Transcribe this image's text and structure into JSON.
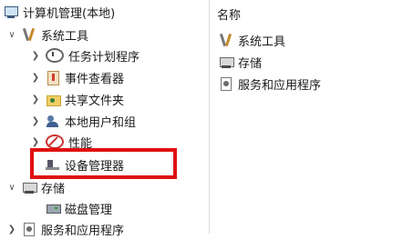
{
  "tree": {
    "root": "计算机管理(本地)",
    "system_tools": "系统工具",
    "task_scheduler": "任务计划程序",
    "event_viewer": "事件查看器",
    "shared_folders": "共享文件夹",
    "local_users": "本地用户和组",
    "performance": "性能",
    "device_manager": "设备管理器",
    "storage": "存储",
    "disk_management": "磁盘管理",
    "services_apps": "服务和应用程序"
  },
  "right": {
    "header": "名称",
    "items": [
      "系统工具",
      "存储",
      "服务和应用程序"
    ]
  },
  "colors": {
    "highlight_border": "#e01010"
  },
  "icons": {
    "root": "computer-management-icon",
    "system_tools": "tools-icon",
    "task_scheduler": "clock-icon",
    "event_viewer": "event-viewer-icon",
    "shared_folders": "shared-folder-icon",
    "local_users": "users-icon",
    "performance": "performance-icon",
    "device_manager": "device-manager-icon",
    "storage": "storage-icon",
    "disk_management": "disk-icon",
    "services_apps": "services-icon"
  }
}
